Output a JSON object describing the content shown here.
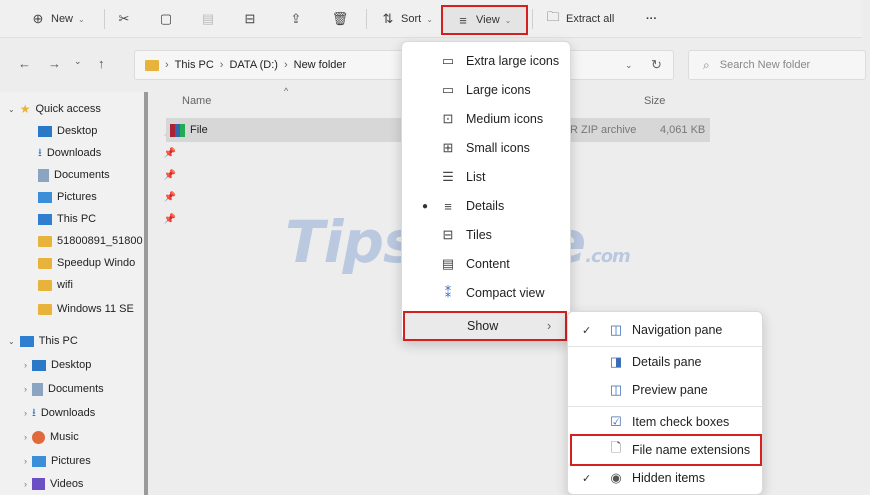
{
  "toolbar": {
    "new_label": "New",
    "sort_label": "Sort",
    "view_label": "View",
    "extract_label": "Extract all",
    "more_label": "···"
  },
  "address": {
    "path": [
      "This PC",
      "DATA (D:)",
      "New folder"
    ],
    "search_placeholder": "Search New folder"
  },
  "sidebar": {
    "quick_access": "Quick access",
    "quick_items": [
      "Desktop",
      "Downloads",
      "Documents",
      "Pictures",
      "This PC",
      "51800891_51800",
      "Speedup Windo",
      "wifi",
      "Windows 11 SE"
    ],
    "this_pc": "This PC",
    "pc_items": [
      "Desktop",
      "Documents",
      "Downloads",
      "Music",
      "Pictures",
      "Videos"
    ]
  },
  "content": {
    "col_name": "Name",
    "col_size": "Size",
    "file_name": "File",
    "file_type": "R ZIP archive",
    "file_size": "4,061 KB"
  },
  "view_menu": {
    "items": [
      "Extra large icons",
      "Large icons",
      "Medium icons",
      "Small icons",
      "List",
      "Details",
      "Tiles",
      "Content",
      "Compact view"
    ],
    "selected": "Details",
    "show_label": "Show"
  },
  "show_menu": {
    "items": [
      "Navigation pane",
      "Details pane",
      "Preview pane",
      "Item check boxes",
      "File name extensions",
      "Hidden items"
    ],
    "checked": [
      "Navigation pane",
      "Hidden items"
    ],
    "highlighted": "File name extensions"
  },
  "watermark": {
    "main": "TipsMake",
    "suffix": ".com"
  },
  "colors": {
    "highlight_border": "#d61f1f",
    "accent": "#3b6fc0",
    "folder": "#e8b33b"
  }
}
